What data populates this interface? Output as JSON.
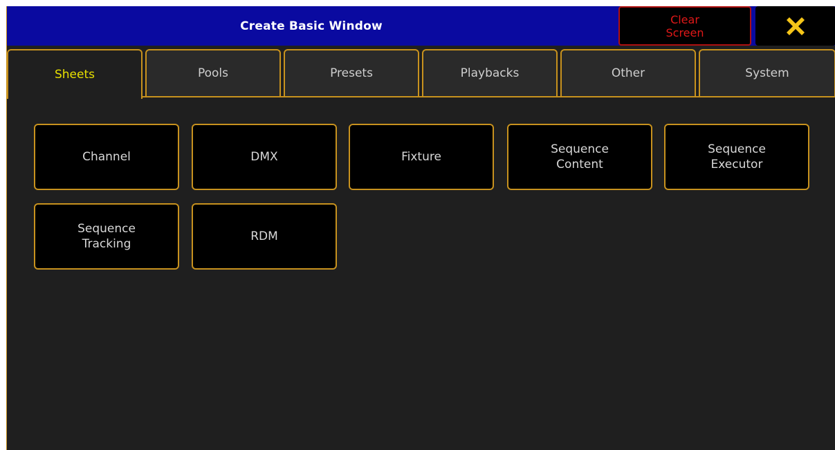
{
  "window": {
    "title": "Create Basic Window",
    "clear_screen_label": "Clear\nScreen",
    "close_icon": "close-x-icon",
    "colors": {
      "title_bar": "#0a0aa0",
      "accent_border": "#c8921e",
      "active_tab_text": "#e8e000",
      "clear_text": "#e01818",
      "close_icon": "#f5c518"
    }
  },
  "tabs": [
    {
      "label": "Sheets",
      "active": true
    },
    {
      "label": "Pools",
      "active": false
    },
    {
      "label": "Presets",
      "active": false
    },
    {
      "label": "Playbacks",
      "active": false
    },
    {
      "label": "Other",
      "active": false
    },
    {
      "label": "System",
      "active": false
    }
  ],
  "sheets": [
    {
      "label": "Channel"
    },
    {
      "label": "DMX"
    },
    {
      "label": "Fixture"
    },
    {
      "label": "Sequence\nContent"
    },
    {
      "label": "Sequence\nExecutor"
    },
    {
      "label": "Sequence\nTracking"
    },
    {
      "label": "RDM"
    }
  ]
}
